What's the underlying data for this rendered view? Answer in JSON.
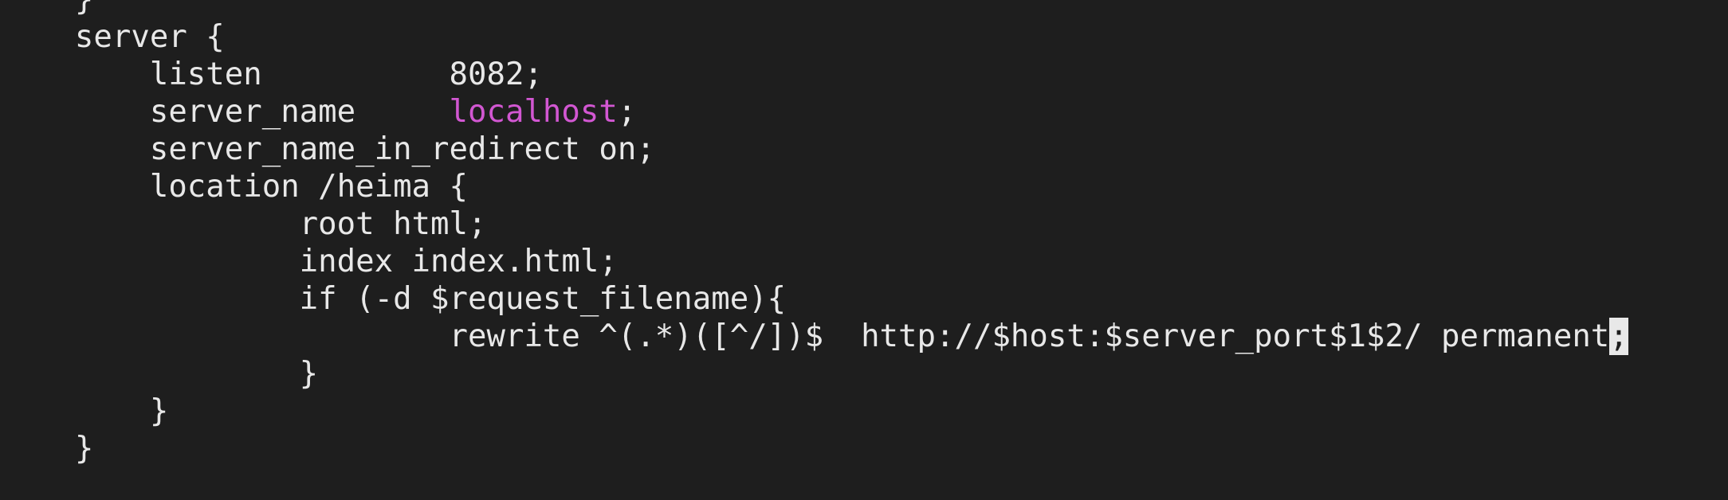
{
  "editor": {
    "lines": [
      {
        "segments": [
          {
            "text": "    }"
          }
        ]
      },
      {
        "segments": [
          {
            "text": "    server {"
          }
        ]
      },
      {
        "segments": [
          {
            "text": "        listen          8082;"
          }
        ]
      },
      {
        "segments": [
          {
            "text": "        server_name     "
          },
          {
            "text": "localhost",
            "highlight": "keyword"
          },
          {
            "text": ";"
          }
        ]
      },
      {
        "segments": [
          {
            "text": "        server_name_in_redirect on;"
          }
        ]
      },
      {
        "segments": [
          {
            "text": "        location /heima {"
          }
        ]
      },
      {
        "segments": [
          {
            "text": "                root html;"
          }
        ]
      },
      {
        "segments": [
          {
            "text": "                index index.html;"
          }
        ]
      },
      {
        "segments": [
          {
            "text": "                if (-d $request_filename){"
          }
        ]
      },
      {
        "segments": [
          {
            "text": "                        rewrite ^(.*)([^/])$  http://$host:$server_port$1$2/ permanent"
          },
          {
            "text": ";",
            "highlight": "cursor"
          }
        ]
      },
      {
        "segments": [
          {
            "text": "                }"
          }
        ]
      },
      {
        "segments": [
          {
            "text": "        }"
          }
        ]
      },
      {
        "segments": [
          {
            "text": "    }"
          }
        ]
      }
    ],
    "colors": {
      "background": "#1e1e1e",
      "foreground": "#e8e8e8",
      "keyword": "#d257d2",
      "cursor": "#e8e8e8"
    }
  }
}
